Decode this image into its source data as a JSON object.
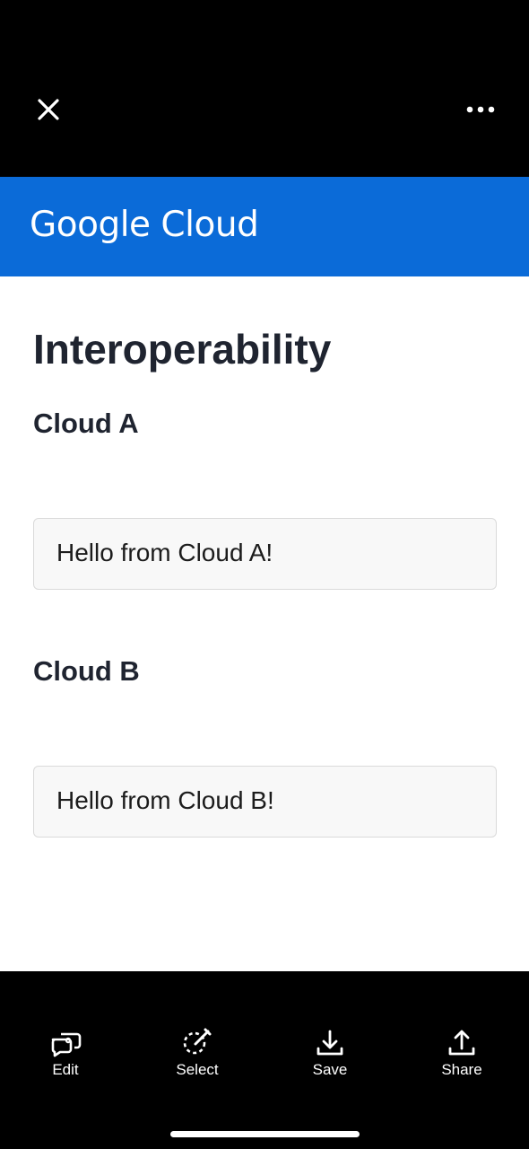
{
  "header": {
    "close_icon": "close-icon",
    "more_icon": "more-horizontal-icon"
  },
  "brand": {
    "logo_text": "Google Cloud",
    "color": "#0b6bd8"
  },
  "page": {
    "title": "Interoperability",
    "sections": [
      {
        "title": "Cloud A",
        "message": "Hello from Cloud A!"
      },
      {
        "title": "Cloud B",
        "message": "Hello from Cloud B!"
      }
    ]
  },
  "toolbar": {
    "edit_label": "Edit",
    "select_label": "Select",
    "save_label": "Save",
    "share_label": "Share"
  }
}
